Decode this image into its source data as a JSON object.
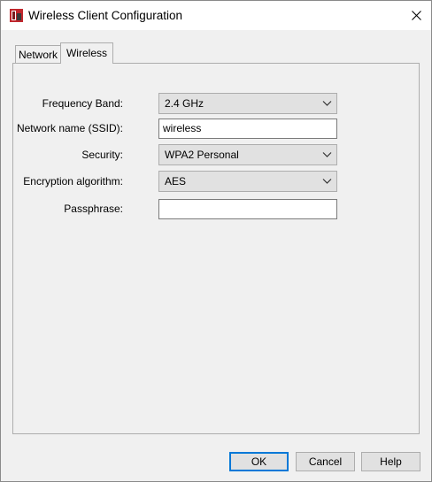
{
  "window": {
    "title": "Wireless Client Configuration",
    "app_icon": "app-icon",
    "close_icon": "close-icon"
  },
  "tabs": [
    {
      "label": "Network",
      "selected": false
    },
    {
      "label": "Wireless",
      "selected": true
    }
  ],
  "form": {
    "frequency_band": {
      "label": "Frequency Band:",
      "value": "2.4 GHz"
    },
    "ssid": {
      "label": "Network name (SSID):",
      "value": "wireless"
    },
    "security": {
      "label": "Security:",
      "value": "WPA2 Personal"
    },
    "encryption": {
      "label": "Encryption algorithm:",
      "value": "AES"
    },
    "passphrase": {
      "label": "Passphrase:",
      "value": ""
    }
  },
  "buttons": {
    "ok": "OK",
    "cancel": "Cancel",
    "help": "Help"
  },
  "colors": {
    "dialog_bg": "#f0f0f0",
    "focus_border": "#0078d7",
    "app_icon_red": "#c0272d"
  }
}
